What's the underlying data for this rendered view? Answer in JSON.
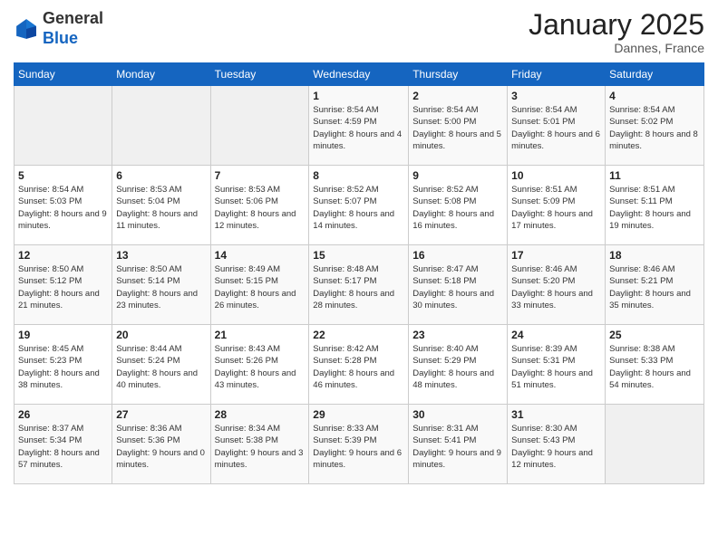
{
  "logo": {
    "general": "General",
    "blue": "Blue"
  },
  "header": {
    "month_year": "January 2025",
    "location": "Dannes, France"
  },
  "weekdays": [
    "Sunday",
    "Monday",
    "Tuesday",
    "Wednesday",
    "Thursday",
    "Friday",
    "Saturday"
  ],
  "weeks": [
    [
      {
        "day": "",
        "info": ""
      },
      {
        "day": "",
        "info": ""
      },
      {
        "day": "",
        "info": ""
      },
      {
        "day": "1",
        "info": "Sunrise: 8:54 AM\nSunset: 4:59 PM\nDaylight: 8 hours and 4 minutes."
      },
      {
        "day": "2",
        "info": "Sunrise: 8:54 AM\nSunset: 5:00 PM\nDaylight: 8 hours and 5 minutes."
      },
      {
        "day": "3",
        "info": "Sunrise: 8:54 AM\nSunset: 5:01 PM\nDaylight: 8 hours and 6 minutes."
      },
      {
        "day": "4",
        "info": "Sunrise: 8:54 AM\nSunset: 5:02 PM\nDaylight: 8 hours and 8 minutes."
      }
    ],
    [
      {
        "day": "5",
        "info": "Sunrise: 8:54 AM\nSunset: 5:03 PM\nDaylight: 8 hours and 9 minutes."
      },
      {
        "day": "6",
        "info": "Sunrise: 8:53 AM\nSunset: 5:04 PM\nDaylight: 8 hours and 11 minutes."
      },
      {
        "day": "7",
        "info": "Sunrise: 8:53 AM\nSunset: 5:06 PM\nDaylight: 8 hours and 12 minutes."
      },
      {
        "day": "8",
        "info": "Sunrise: 8:52 AM\nSunset: 5:07 PM\nDaylight: 8 hours and 14 minutes."
      },
      {
        "day": "9",
        "info": "Sunrise: 8:52 AM\nSunset: 5:08 PM\nDaylight: 8 hours and 16 minutes."
      },
      {
        "day": "10",
        "info": "Sunrise: 8:51 AM\nSunset: 5:09 PM\nDaylight: 8 hours and 17 minutes."
      },
      {
        "day": "11",
        "info": "Sunrise: 8:51 AM\nSunset: 5:11 PM\nDaylight: 8 hours and 19 minutes."
      }
    ],
    [
      {
        "day": "12",
        "info": "Sunrise: 8:50 AM\nSunset: 5:12 PM\nDaylight: 8 hours and 21 minutes."
      },
      {
        "day": "13",
        "info": "Sunrise: 8:50 AM\nSunset: 5:14 PM\nDaylight: 8 hours and 23 minutes."
      },
      {
        "day": "14",
        "info": "Sunrise: 8:49 AM\nSunset: 5:15 PM\nDaylight: 8 hours and 26 minutes."
      },
      {
        "day": "15",
        "info": "Sunrise: 8:48 AM\nSunset: 5:17 PM\nDaylight: 8 hours and 28 minutes."
      },
      {
        "day": "16",
        "info": "Sunrise: 8:47 AM\nSunset: 5:18 PM\nDaylight: 8 hours and 30 minutes."
      },
      {
        "day": "17",
        "info": "Sunrise: 8:46 AM\nSunset: 5:20 PM\nDaylight: 8 hours and 33 minutes."
      },
      {
        "day": "18",
        "info": "Sunrise: 8:46 AM\nSunset: 5:21 PM\nDaylight: 8 hours and 35 minutes."
      }
    ],
    [
      {
        "day": "19",
        "info": "Sunrise: 8:45 AM\nSunset: 5:23 PM\nDaylight: 8 hours and 38 minutes."
      },
      {
        "day": "20",
        "info": "Sunrise: 8:44 AM\nSunset: 5:24 PM\nDaylight: 8 hours and 40 minutes."
      },
      {
        "day": "21",
        "info": "Sunrise: 8:43 AM\nSunset: 5:26 PM\nDaylight: 8 hours and 43 minutes."
      },
      {
        "day": "22",
        "info": "Sunrise: 8:42 AM\nSunset: 5:28 PM\nDaylight: 8 hours and 46 minutes."
      },
      {
        "day": "23",
        "info": "Sunrise: 8:40 AM\nSunset: 5:29 PM\nDaylight: 8 hours and 48 minutes."
      },
      {
        "day": "24",
        "info": "Sunrise: 8:39 AM\nSunset: 5:31 PM\nDaylight: 8 hours and 51 minutes."
      },
      {
        "day": "25",
        "info": "Sunrise: 8:38 AM\nSunset: 5:33 PM\nDaylight: 8 hours and 54 minutes."
      }
    ],
    [
      {
        "day": "26",
        "info": "Sunrise: 8:37 AM\nSunset: 5:34 PM\nDaylight: 8 hours and 57 minutes."
      },
      {
        "day": "27",
        "info": "Sunrise: 8:36 AM\nSunset: 5:36 PM\nDaylight: 9 hours and 0 minutes."
      },
      {
        "day": "28",
        "info": "Sunrise: 8:34 AM\nSunset: 5:38 PM\nDaylight: 9 hours and 3 minutes."
      },
      {
        "day": "29",
        "info": "Sunrise: 8:33 AM\nSunset: 5:39 PM\nDaylight: 9 hours and 6 minutes."
      },
      {
        "day": "30",
        "info": "Sunrise: 8:31 AM\nSunset: 5:41 PM\nDaylight: 9 hours and 9 minutes."
      },
      {
        "day": "31",
        "info": "Sunrise: 8:30 AM\nSunset: 5:43 PM\nDaylight: 9 hours and 12 minutes."
      },
      {
        "day": "",
        "info": ""
      }
    ]
  ]
}
